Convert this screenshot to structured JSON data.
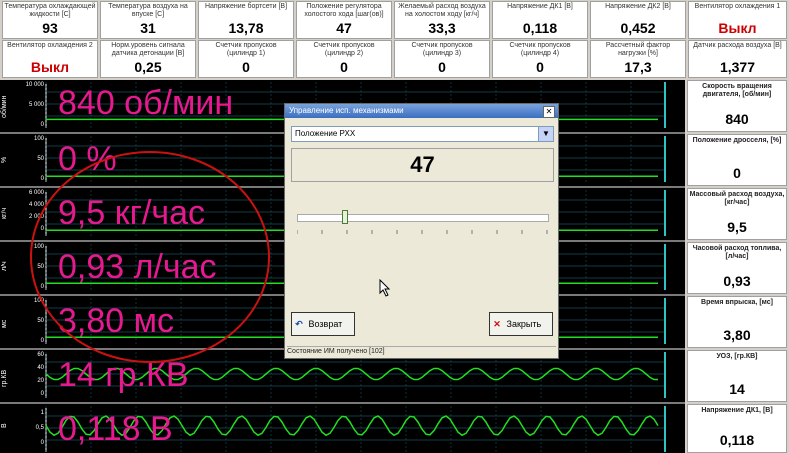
{
  "top_cells": [
    {
      "label": "Температура охлаждающей жидкости [С]",
      "value": "93"
    },
    {
      "label": "Температура воздуха на впуске [С]",
      "value": "31"
    },
    {
      "label": "Напряжение бортсети [В]",
      "value": "13,78"
    },
    {
      "label": "Положение регулятора холостого хода [шаг(ов)]",
      "value": "47"
    },
    {
      "label": "Желаемый расход воздуха на холостом ходу [кг/ч]",
      "value": "33,3"
    },
    {
      "label": "Напряжение ДК1 [В]",
      "value": "0,118"
    },
    {
      "label": "Напряжение ДК2 [В]",
      "value": "0,452"
    },
    {
      "label": "Вентилятор охлаждения 1",
      "value": "Выкл"
    },
    {
      "label": "Вентилятор охлаждения 2",
      "value": "Выкл"
    },
    {
      "label": "Норм.уровень сигнала датчика детонации [В]",
      "value": "0,25"
    },
    {
      "label": "Счетчик пропусков (цилиндр 1)",
      "value": "0"
    },
    {
      "label": "Счетчик пропусков (цилиндр 2)",
      "value": "0"
    },
    {
      "label": "Счетчик пропусков (цилиндр 3)",
      "value": "0"
    },
    {
      "label": "Счетчик пропусков (цилиндр 4)",
      "value": "0"
    },
    {
      "label": "Рассчетный фактор нагрузки [%]",
      "value": "17,3"
    },
    {
      "label": "Датчик расхода воздуха [В]",
      "value": "1,377"
    }
  ],
  "charts": [
    {
      "axis": "об/мин",
      "ticks": [
        "10 000",
        "5 000",
        "0"
      ],
      "overlay": "840 об/мин"
    },
    {
      "axis": "%",
      "ticks": [
        "100",
        "50",
        "0"
      ],
      "overlay": "0 %"
    },
    {
      "axis": "кг/ч",
      "ticks": [
        "6 000",
        "4 000",
        "2 000",
        "0"
      ],
      "overlay": "9,5 кг/час"
    },
    {
      "axis": "л/ч",
      "ticks": [
        "100",
        "50",
        "0"
      ],
      "overlay": "0,93 л/час"
    },
    {
      "axis": "мс",
      "ticks": [
        "100",
        "50",
        "0"
      ],
      "overlay": "3,80 мс"
    },
    {
      "axis": "гр.КВ",
      "ticks": [
        "60",
        "40",
        "20",
        "0"
      ],
      "overlay": "14 гр.КВ"
    },
    {
      "axis": "В",
      "ticks": [
        "1",
        "0,5",
        "0"
      ],
      "overlay": "0,118 В"
    }
  ],
  "right_cells": [
    {
      "label": "Скорость вращения двигателя, [об/мин]",
      "value": "840"
    },
    {
      "label": "Положение дросселя, [%]",
      "value": "0"
    },
    {
      "label": "Массовый расход воздуха, [кг/час]",
      "value": "9,5"
    },
    {
      "label": "Часовой расход топлива, [л/час]",
      "value": "0,93"
    },
    {
      "label": "Время впрыска, [мс]",
      "value": "3,80"
    },
    {
      "label": "УОЗ, [гр.КВ]",
      "value": "14"
    },
    {
      "label": "Напряжение ДК1, [В]",
      "value": "0,118"
    }
  ],
  "dialog": {
    "title": "Управление исп. механизмами",
    "select_value": "Положение РХХ",
    "big_value": "47",
    "slider_level": 0.19,
    "back_label": "Возврат",
    "close_label": "Закрыть",
    "status": "Состояние ИМ получено [102]"
  },
  "colors": {
    "accent": "#e6198f",
    "trace": "#22dd22",
    "grid": "#1e7a8c",
    "bg": "#000000"
  }
}
